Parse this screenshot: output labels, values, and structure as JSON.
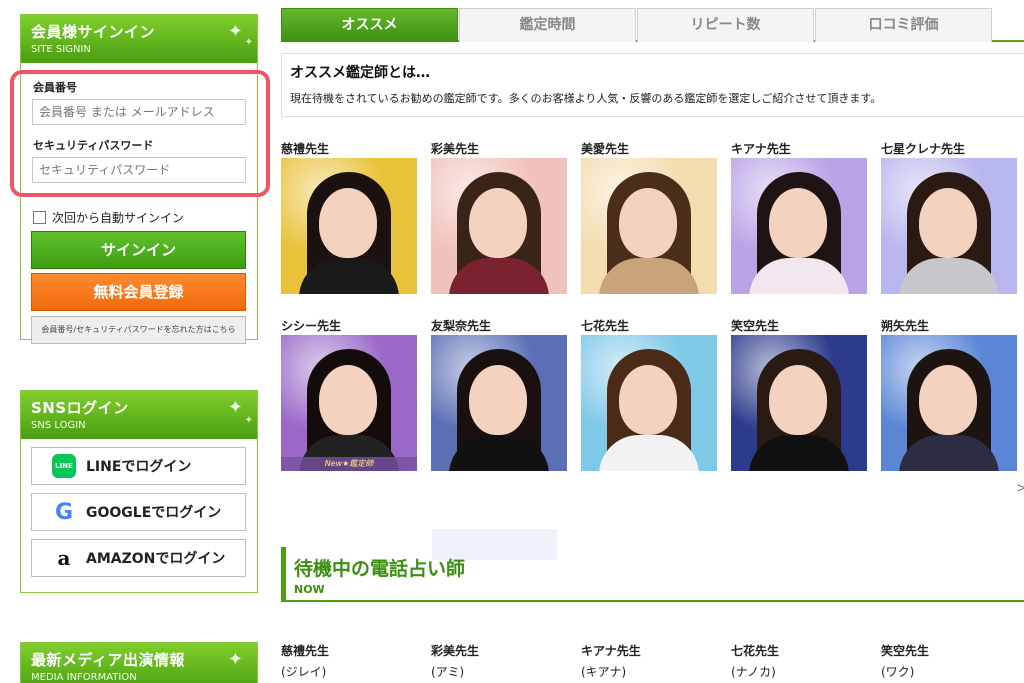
{
  "signin": {
    "title": "会員様サインイン",
    "subtitle": "SITE SIGNIN",
    "member_label": "会員番号",
    "member_placeholder": "会員番号 または メールアドレス",
    "password_label": "セキュリティパスワード",
    "password_placeholder": "セキュリティパスワード",
    "auto_signin": "次回から自動サインイン",
    "signin_button": "サインイン",
    "register_button": "無料会員登録",
    "forgot_link": "会員番号/セキュリティパスワードを忘れた方はこちら"
  },
  "sns": {
    "title": "SNSログイン",
    "subtitle": "SNS LOGIN",
    "line": "LINEでログイン",
    "line_icon_text": "LINE",
    "google": "GOOGLEでログイン",
    "amazon": "AMAZONでログイン"
  },
  "media": {
    "title": "最新メディア出演情報",
    "subtitle": "MEDIA INFORMATION"
  },
  "tabs": [
    "オススメ",
    "鑑定時間",
    "リピート数",
    "口コミ評価"
  ],
  "intro": {
    "title": "オススメ鑑定師とは…",
    "text": "現在待機をされているお勧めの鑑定師です。多くのお客様より人気・反響のある鑑定師を選定しご紹介させて頂きます。"
  },
  "advisors": [
    {
      "name": "慈禮先生",
      "bg": "#e9c23a",
      "hair": "#1b1110",
      "cloth": "#1a1a1a"
    },
    {
      "name": "彩美先生",
      "bg": "#f1c2bb",
      "hair": "#3a2418",
      "cloth": "#7b2230"
    },
    {
      "name": "美愛先生",
      "bg": "#f4dcae",
      "hair": "#4a2d1a",
      "cloth": "#c9a37a"
    },
    {
      "name": "キアナ先生",
      "bg": "#b9a3e6",
      "hair": "#1e1414",
      "cloth": "#f1e7ee"
    },
    {
      "name": "七星クレナ先生",
      "bg": "#b8b6ee",
      "hair": "#2b1a12",
      "cloth": "#c8c6cd"
    },
    {
      "name": "シシー先生",
      "bg": "#9a69c8",
      "hair": "#140c0a",
      "cloth": "#222222"
    },
    {
      "name": "友梨奈先生",
      "bg": "#5b6fb5",
      "hair": "#1a1010",
      "cloth": "#111111"
    },
    {
      "name": "七花先生",
      "bg": "#7ec8e8",
      "hair": "#4b2a18",
      "cloth": "#f2f2f2"
    },
    {
      "name": "笑空先生",
      "bg": "#2d3b8c",
      "hair": "#2a1a14",
      "cloth": "#111111"
    },
    {
      "name": "朔矢先生",
      "bg": "#5b86d6",
      "hair": "#1d1412",
      "cloth": "#2c2c44"
    }
  ],
  "new_tag": "New★鑑定師",
  "now_section": {
    "title": "待機中の電話占い師",
    "subtitle": "NOW"
  },
  "bottom_advisors": [
    {
      "name": "慈禮先生",
      "reading": "(ジレイ)"
    },
    {
      "name": "彩美先生",
      "reading": "(アミ)"
    },
    {
      "name": "キアナ先生",
      "reading": "(キアナ)"
    },
    {
      "name": "七花先生",
      "reading": "(ナノカ)"
    },
    {
      "name": "笑空先生",
      "reading": "(ワク)"
    }
  ],
  "colors": {
    "accent_green": "#4a9f12",
    "accent_orange": "#f06a0a",
    "highlight": "#ee5566"
  }
}
